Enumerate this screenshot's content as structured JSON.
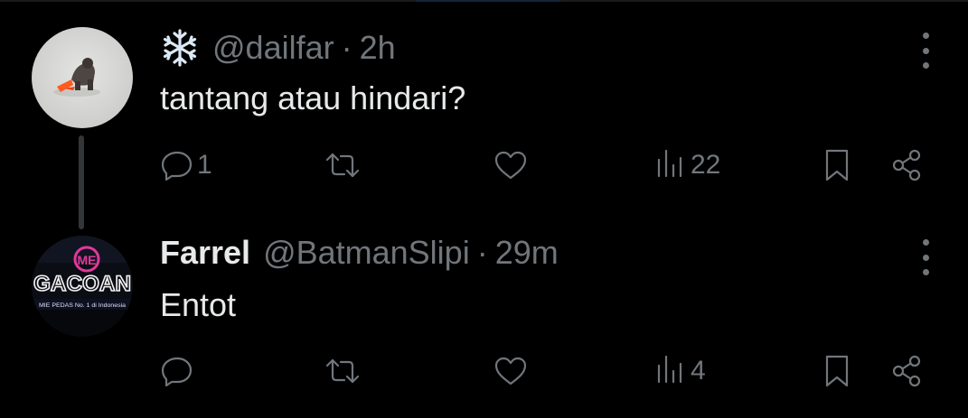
{
  "tweets": [
    {
      "author_name": "",
      "author_name_icon": "snowflake-emoji",
      "handle": "@dailfar",
      "separator": "·",
      "time": "2h",
      "text": "tantang atau hindari?",
      "reply_count": "1",
      "retweet_count": "",
      "like_count": "",
      "view_count": "22"
    },
    {
      "author_name": "Farrel",
      "handle": "@BatmanSlipi",
      "separator": "·",
      "time": "29m",
      "text": "Entot",
      "reply_count": "",
      "retweet_count": "",
      "like_count": "",
      "view_count": "4"
    }
  ],
  "avatar_2": {
    "sign_brand": "ME",
    "sign_name": "GACOAN",
    "sign_tagline": "MIE PEDAS No. 1 di Indonesia"
  },
  "colors": {
    "background": "#000000",
    "text_primary": "#e7e9ea",
    "text_secondary": "#71767b",
    "thread_line": "#333639",
    "sign_pink": "#e0399b"
  },
  "icons": [
    "reply-icon",
    "retweet-icon",
    "like-icon",
    "views-icon",
    "bookmark-icon",
    "share-icon",
    "more-icon"
  ]
}
